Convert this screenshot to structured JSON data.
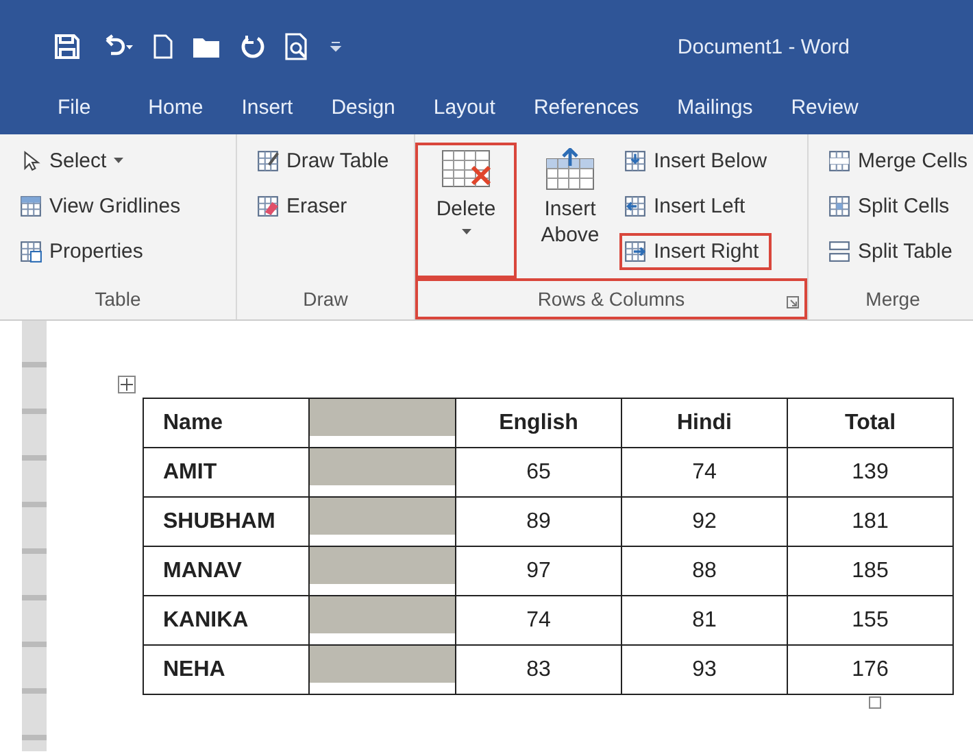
{
  "window": {
    "title": "Document1 - Word"
  },
  "tabs": [
    {
      "label": "File"
    },
    {
      "label": "Home"
    },
    {
      "label": "Insert"
    },
    {
      "label": "Design"
    },
    {
      "label": "Layout"
    },
    {
      "label": "References"
    },
    {
      "label": "Mailings"
    },
    {
      "label": "Review"
    }
  ],
  "ribbon": {
    "groups": [
      {
        "label": "Table",
        "highlighted": false,
        "items": [
          {
            "kind": "small",
            "label": "Select",
            "dropdown": true,
            "highlighted": false
          },
          {
            "kind": "small",
            "label": "View Gridlines",
            "dropdown": false,
            "highlighted": false
          },
          {
            "kind": "small",
            "label": "Properties",
            "dropdown": false,
            "highlighted": false
          }
        ]
      },
      {
        "label": "Draw",
        "highlighted": false,
        "items": [
          {
            "kind": "small",
            "label": "Draw Table",
            "dropdown": false,
            "highlighted": false
          },
          {
            "kind": "small",
            "label": "Eraser",
            "dropdown": false,
            "highlighted": false
          }
        ]
      },
      {
        "label": "Rows & Columns",
        "highlighted": true,
        "items": [
          {
            "kind": "large",
            "label": "Delete",
            "dropdown": true,
            "highlighted": true
          },
          {
            "kind": "large",
            "label": "Insert Above",
            "dropdown": false,
            "highlighted": false
          },
          {
            "kind": "small",
            "label": "Insert Below",
            "dropdown": false,
            "highlighted": false
          },
          {
            "kind": "small",
            "label": "Insert Left",
            "dropdown": false,
            "highlighted": false
          },
          {
            "kind": "small",
            "label": "Insert Right",
            "dropdown": false,
            "highlighted": true
          }
        ]
      },
      {
        "label": "Merge",
        "highlighted": false,
        "items": [
          {
            "kind": "small",
            "label": "Merge Cells",
            "dropdown": false,
            "highlighted": false
          },
          {
            "kind": "small",
            "label": "Split Cells",
            "dropdown": false,
            "highlighted": false
          },
          {
            "kind": "small",
            "label": "Split Table",
            "dropdown": false,
            "highlighted": false
          }
        ]
      }
    ]
  },
  "table": {
    "columns": [
      {
        "label": "Name",
        "selected": false
      },
      {
        "selected": true
      },
      {
        "label": "English",
        "selected": false
      },
      {
        "label": "Hindi",
        "selected": false
      },
      {
        "label": "Total",
        "selected": false
      }
    ],
    "rows": [
      {
        "cells": [
          "AMIT",
          "",
          "65",
          "74",
          "139"
        ]
      },
      {
        "cells": [
          "SHUBHAM",
          "",
          "89",
          "92",
          "181"
        ]
      },
      {
        "cells": [
          "MANAV",
          "",
          "97",
          "88",
          "185"
        ]
      },
      {
        "cells": [
          "KANIKA",
          "",
          "74",
          "81",
          "155"
        ]
      },
      {
        "cells": [
          "NEHA",
          "",
          "83",
          "93",
          "176"
        ]
      }
    ]
  }
}
